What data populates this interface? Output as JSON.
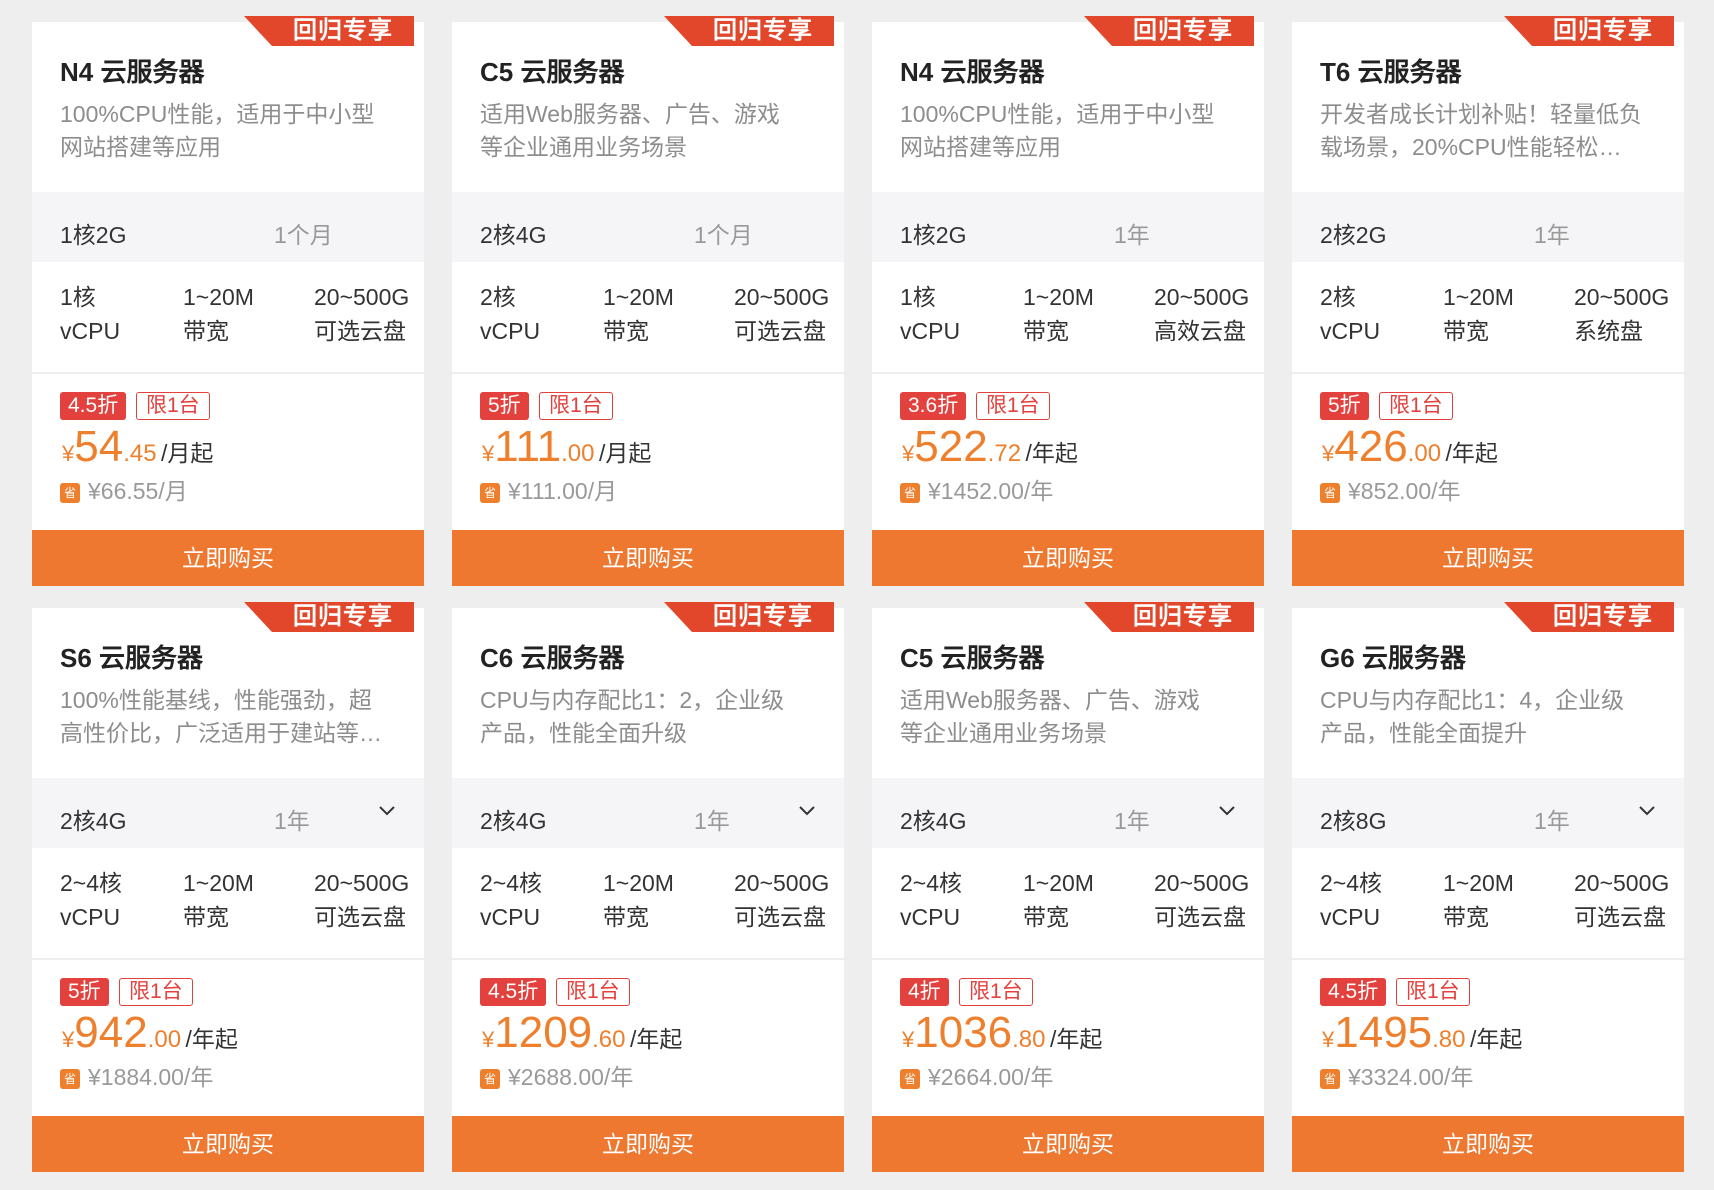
{
  "common": {
    "ribbon_label": "回归专享",
    "limit_label": "限1台",
    "buy_label": "立即购买",
    "save_icon_char": "省",
    "currency": "¥",
    "accent_color": "#ee7830",
    "discount_color": "#e3413d"
  },
  "cards": [
    {
      "title": "N4 云服务器",
      "desc": [
        "100%CPU性能，适用于中小型",
        "网站搭建等应用"
      ],
      "spec": "1核2G",
      "term": "1个月",
      "has_dropdown": false,
      "features": [
        {
          "top": "1核",
          "bottom": "vCPU"
        },
        {
          "top": "1~20M",
          "bottom": "带宽"
        },
        {
          "top": "20~500G",
          "bottom": "可选云盘"
        }
      ],
      "discount": "4.5折",
      "price_int": "54",
      "price_dec": ".45",
      "price_unit": "/月起",
      "orig_price": "¥66.55/月"
    },
    {
      "title": "C5 云服务器",
      "desc": [
        "适用Web服务器、广告、游戏",
        "等企业通用业务场景"
      ],
      "spec": "2核4G",
      "term": "1个月",
      "has_dropdown": false,
      "features": [
        {
          "top": "2核",
          "bottom": "vCPU"
        },
        {
          "top": "1~20M",
          "bottom": "带宽"
        },
        {
          "top": "20~500G",
          "bottom": "可选云盘"
        }
      ],
      "discount": "5折",
      "price_int": "111",
      "price_dec": ".00",
      "price_unit": "/月起",
      "orig_price": "¥111.00/月"
    },
    {
      "title": "N4 云服务器",
      "desc": [
        "100%CPU性能，适用于中小型",
        "网站搭建等应用"
      ],
      "spec": "1核2G",
      "term": "1年",
      "has_dropdown": false,
      "features": [
        {
          "top": "1核",
          "bottom": "vCPU"
        },
        {
          "top": "1~20M",
          "bottom": "带宽"
        },
        {
          "top": "20~500G",
          "bottom": "高效云盘"
        }
      ],
      "discount": "3.6折",
      "price_int": "522",
      "price_dec": ".72",
      "price_unit": "/年起",
      "orig_price": "¥1452.00/年"
    },
    {
      "title": "T6 云服务器",
      "desc": [
        "开发者成长计划补贴！轻量低负",
        "载场景，20%CPU性能轻松…"
      ],
      "spec": "2核2G",
      "term": "1年",
      "has_dropdown": false,
      "features": [
        {
          "top": "2核",
          "bottom": "vCPU"
        },
        {
          "top": "1~20M",
          "bottom": "带宽"
        },
        {
          "top": "20~500G",
          "bottom": "系统盘"
        }
      ],
      "discount": "5折",
      "price_int": "426",
      "price_dec": ".00",
      "price_unit": "/年起",
      "orig_price": "¥852.00/年"
    },
    {
      "title": "S6 云服务器",
      "desc": [
        "100%性能基线，性能强劲，超",
        "高性价比，广泛适用于建站等…"
      ],
      "spec": "2核4G",
      "term": "1年",
      "has_dropdown": true,
      "features": [
        {
          "top": "2~4核",
          "bottom": "vCPU"
        },
        {
          "top": "1~20M",
          "bottom": "带宽"
        },
        {
          "top": "20~500G",
          "bottom": "可选云盘"
        }
      ],
      "discount": "5折",
      "price_int": "942",
      "price_dec": ".00",
      "price_unit": "/年起",
      "orig_price": "¥1884.00/年"
    },
    {
      "title": "C6 云服务器",
      "desc": [
        "CPU与内存配比1：2，企业级",
        "产品，性能全面升级"
      ],
      "spec": "2核4G",
      "term": "1年",
      "has_dropdown": true,
      "features": [
        {
          "top": "2~4核",
          "bottom": "vCPU"
        },
        {
          "top": "1~20M",
          "bottom": "带宽"
        },
        {
          "top": "20~500G",
          "bottom": "可选云盘"
        }
      ],
      "discount": "4.5折",
      "price_int": "1209",
      "price_dec": ".60",
      "price_unit": "/年起",
      "orig_price": "¥2688.00/年"
    },
    {
      "title": "C5 云服务器",
      "desc": [
        "适用Web服务器、广告、游戏",
        "等企业通用业务场景"
      ],
      "spec": "2核4G",
      "term": "1年",
      "has_dropdown": true,
      "features": [
        {
          "top": "2~4核",
          "bottom": "vCPU"
        },
        {
          "top": "1~20M",
          "bottom": "带宽"
        },
        {
          "top": "20~500G",
          "bottom": "可选云盘"
        }
      ],
      "discount": "4折",
      "price_int": "1036",
      "price_dec": ".80",
      "price_unit": "/年起",
      "orig_price": "¥2664.00/年"
    },
    {
      "title": "G6 云服务器",
      "desc": [
        "CPU与内存配比1：4，企业级",
        "产品，性能全面提升"
      ],
      "spec": "2核8G",
      "term": "1年",
      "has_dropdown": true,
      "features": [
        {
          "top": "2~4核",
          "bottom": "vCPU"
        },
        {
          "top": "1~20M",
          "bottom": "带宽"
        },
        {
          "top": "20~500G",
          "bottom": "可选云盘"
        }
      ],
      "discount": "4.5折",
      "price_int": "1495",
      "price_dec": ".80",
      "price_unit": "/年起",
      "orig_price": "¥3324.00/年"
    }
  ]
}
